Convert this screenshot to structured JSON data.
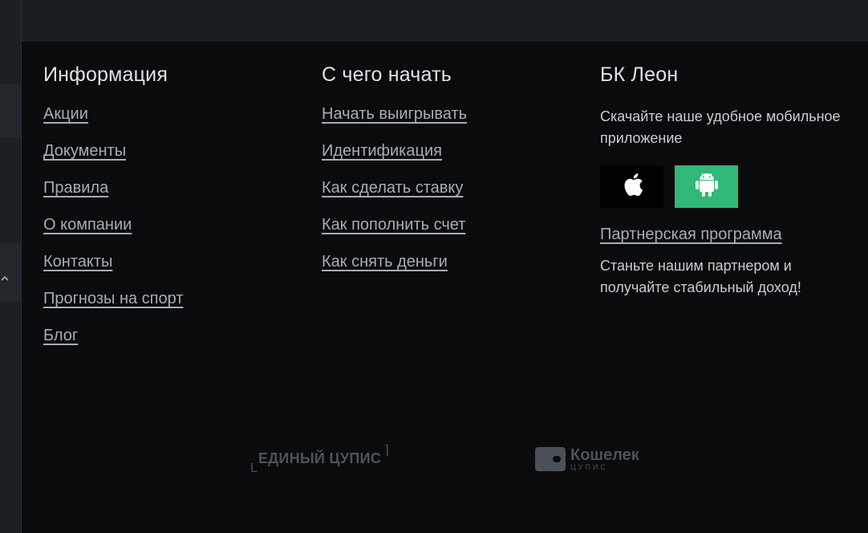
{
  "columns": [
    {
      "title": "Информация",
      "links": [
        "Акции",
        "Документы",
        "Правила",
        "О компании",
        "Контакты",
        "Прогнозы на спорт",
        "Блог"
      ]
    },
    {
      "title": "С чего начать",
      "links": [
        "Начать выигрывать",
        "Идентификация",
        "Как сделать ставку",
        "Как пополнить счет",
        "Как снять деньги"
      ]
    }
  ],
  "brand": {
    "title": "БК Леон",
    "app_text": "Скачайте наше удобное мобильное приложение",
    "ios_icon": "apple-icon",
    "android_icon": "android-icon",
    "partner_link": "Партнерская программа",
    "partner_text": "Станьте нашим партнером и получайте стабильный доход!"
  },
  "logos": {
    "cupis": "ЕДИНЫЙ ЦУПИС",
    "wallet_main": "Кошелек",
    "wallet_sub": "ЦУПИС"
  },
  "colors": {
    "background": "#0a0b0d",
    "link": "#a7adb4",
    "android_green": "#2fb877"
  }
}
